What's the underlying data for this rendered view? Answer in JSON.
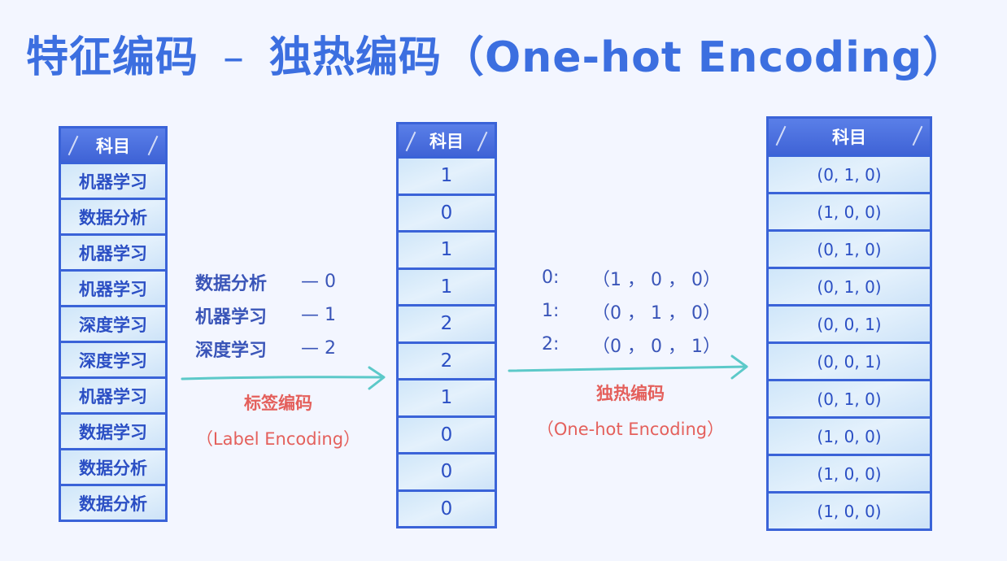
{
  "title": {
    "part1": "特征编码",
    "dash": "–",
    "part2": "独热编码（One-hot Encoding）"
  },
  "table_original": {
    "header": "科目",
    "rows": [
      "机器学习",
      "数据分析",
      "机器学习",
      "机器学习",
      "深度学习",
      "深度学习",
      "机器学习",
      "数据学习",
      "数据分析",
      "数据分析"
    ]
  },
  "label_mapping": [
    {
      "category": "数据分析",
      "code": "— 0"
    },
    {
      "category": "机器学习",
      "code": "— 1"
    },
    {
      "category": "深度学习",
      "code": "— 2"
    }
  ],
  "label_caption": {
    "main": "标签编码",
    "sub": "（Label Encoding）"
  },
  "table_label": {
    "header": "科目",
    "rows": [
      "1",
      "0",
      "1",
      "1",
      "2",
      "2",
      "1",
      "0",
      "0",
      "0"
    ]
  },
  "onehot_mapping": [
    {
      "code": "0:",
      "vector": "（1 ， 0 ， 0）"
    },
    {
      "code": "1:",
      "vector": "（0 ， 1 ， 0）"
    },
    {
      "code": "2:",
      "vector": "（0 ， 0 ， 1）"
    }
  ],
  "onehot_caption": {
    "main": "独热编码",
    "sub": "（One-hot Encoding）"
  },
  "table_onehot": {
    "header": "科目",
    "rows": [
      "(0, 1, 0)",
      "(1, 0, 0)",
      "(0, 1, 0)",
      "(0, 1, 0)",
      "(0, 0, 1)",
      "(0, 0, 1)",
      "(0, 1, 0)",
      "(1, 0, 0)",
      "(1, 0, 0)",
      "(1, 0, 0)"
    ]
  },
  "colors": {
    "title": "#3c6fe0",
    "table_border": "#3a63d8",
    "header_fill": "#4a6fe0",
    "cell_fill": "#d6eafb",
    "caption": "#e4605c",
    "arrow": "#5cc9c9"
  }
}
